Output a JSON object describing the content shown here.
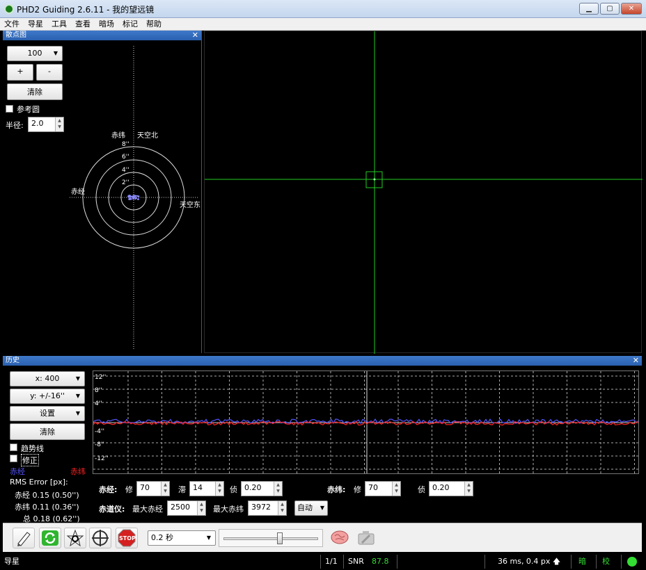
{
  "window": {
    "title": "PHD2 Guiding 2.6.11 - 我的望远镜",
    "minimize": "▁",
    "maximize": "▢",
    "close": "✕"
  },
  "menu": [
    "文件",
    "导星",
    "工具",
    "查看",
    "暗场",
    "标记",
    "帮助"
  ],
  "target_panel": {
    "title": "散点图",
    "zoom_value": "100",
    "plus_label": "+",
    "minus_label": "-",
    "clear_label": "清除",
    "reference_circle_label": "参考圆",
    "radius_label": "半径:",
    "radius_value": "2.0",
    "axis_ra_label": "赤经",
    "axis_dec_label": "赤纬",
    "north_label": "天空北",
    "east_label": "天空东",
    "ring_labels": [
      "8''",
      "6''",
      "4''",
      "2''"
    ],
    "points_color": "#8a8aff"
  },
  "camera_view": {
    "crosshair_color": "#22cc22"
  },
  "history": {
    "title": "历史",
    "x_scale": "x: 400",
    "y_scale": "y: +/-16''",
    "settings_label": "设置",
    "clear_label": "清除",
    "trendline_label": "趋势线",
    "corrections_label": "修正",
    "ra_legend": "赤经",
    "dec_legend": "赤纬",
    "ra_color": "#5555ff",
    "dec_color": "#ff2222",
    "rms_title": "RMS Error [px]:",
    "rms_ra": "赤经 0.15 (0.50'')",
    "rms_dec": "赤纬 0.11 (0.36'')",
    "rms_total": "总 0.18 (0.62'')",
    "y_tick_labels": [
      "12''",
      "8''",
      "4''",
      "-4''",
      "-8''",
      "-12''"
    ]
  },
  "controls": {
    "ra_label": "赤经:",
    "ra_agg_label": "修",
    "ra_agg_value": "70",
    "ra_hys_label": "滞",
    "ra_hys_value": "14",
    "ra_min_label": "侦",
    "ra_min_value": "0.20",
    "dec_label": "赤纬:",
    "dec_agg_label": "修",
    "dec_agg_value": "70",
    "dec_min_label": "侦",
    "dec_min_value": "0.20",
    "mount_label": "赤道仪:",
    "max_ra_label": "最大赤经",
    "max_ra_value": "2500",
    "max_dec_label": "最大赤纬",
    "max_dec_value": "3972",
    "dec_mode": "自动"
  },
  "toolbar": {
    "exposure_value": "0.2 秒",
    "exposure_level": 0.6,
    "stop_label": "STOP"
  },
  "status": {
    "left": "导星",
    "frames": "1/1",
    "snr_label": "SNR",
    "snr_value": "87.8",
    "pulse": "36 ms, 0.4 px",
    "dark": "暗",
    "cal": "校",
    "green": "#33dd33"
  }
}
